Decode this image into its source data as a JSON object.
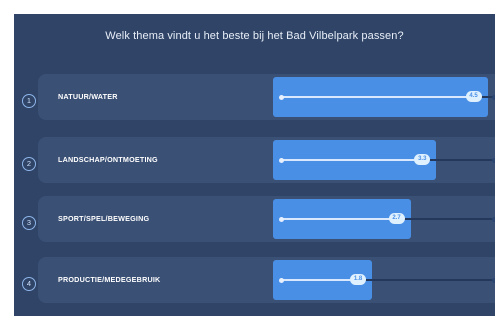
{
  "question": "Welk thema vindt u het beste bij het Bad Vilbelpark passen?",
  "colors": {
    "background": "#2f4466",
    "row": "#3a5075",
    "accent": "#4a8fe6"
  },
  "items": [
    {
      "number": "1",
      "label": "NATUUR/WATER",
      "value": 4.5,
      "value_label": "4.5",
      "max": 5,
      "max_label": "5"
    },
    {
      "number": "2",
      "label": "LANDSCHAP/ONTMOETING",
      "value": 3.3,
      "value_label": "3.3",
      "max": 5,
      "max_label": "5"
    },
    {
      "number": "3",
      "label": "SPORT/SPEL/BEWEGING",
      "value": 2.7,
      "value_label": "2.7",
      "max": 5,
      "max_label": "5"
    },
    {
      "number": "4",
      "label": "PRODUCTIE/MEDEGEBRUIK",
      "value": 1.8,
      "value_label": "1.8",
      "max": 5,
      "max_label": "5"
    }
  ]
}
